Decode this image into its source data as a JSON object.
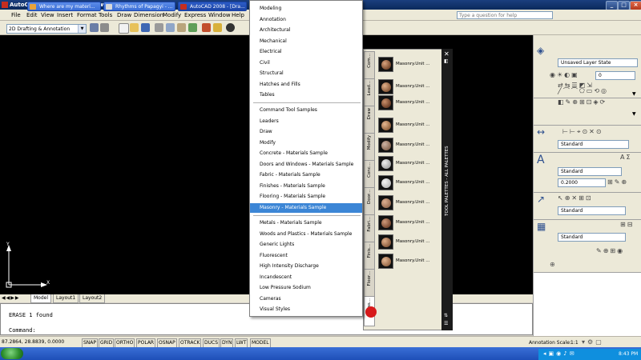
{
  "window": {
    "title": "AutoCAD 2008 - [Drawing1.dwg]",
    "min": "_",
    "max": "□",
    "close": "×"
  },
  "menu": [
    "File",
    "Edit",
    "View",
    "Insert",
    "Format",
    "Tools",
    "Draw",
    "Dimension",
    "Modify",
    "Express",
    "Window",
    "Help"
  ],
  "help_placeholder": "Type a question for help",
  "workspace": "2D Drafting & Annotation",
  "dropdown": {
    "group1": [
      "Modeling",
      "Annotation",
      "Architectural",
      "Mechanical",
      "Electrical",
      "Civil",
      "Structural",
      "Hatches and Fills",
      "Tables"
    ],
    "group2": [
      "Command Tool Samples",
      "Leaders",
      "Draw",
      "Modify",
      "Concrete - Materials Sample",
      "Doors and Windows - Materials Sample",
      "Fabric - Materials Sample",
      "Finishes - Materials Sample",
      "Flooring - Materials Sample",
      "Masonry - Materials Sample"
    ],
    "group3": [
      "Metals - Materials Sample",
      "Woods and Plastics - Materials Sample",
      "Generic Lights",
      "Fluorescent",
      "High Intensity Discharge",
      "Incandescent",
      "Low Pressure Sodium",
      "Cameras",
      "Visual Styles"
    ],
    "selected": "Masonry - Materials Sample"
  },
  "palette": {
    "title": "TOOL PALETTES - ALL PALETTES",
    "close": "✕",
    "tabs": [
      "Com...",
      "Lead...",
      "Draw",
      "Modify",
      "Conc...",
      "Door...",
      "Fabri...",
      "Finis...",
      "Floor...",
      "Mas..."
    ],
    "tools": [
      "Masonry.Unit ...",
      "Masonry.Unit ...",
      "Masonry.Unit ...",
      "Masonry.Unit ...",
      "Masonry.Unit ...",
      "Masonry.Unit ...",
      "Masonry.Unit ...",
      "Masonry.Unit ...",
      "Masonry.Unit ...",
      "Masonry.Unit ...",
      "Masonry.Unit ..."
    ],
    "swatch_colors": [
      "#7a4a2e",
      "#8a5a3a",
      "#6e3f28",
      "#94643f",
      "#8b6a55",
      "#a9a9a9",
      "#c0c0c0",
      "#9c7055",
      "#7c4b33",
      "#8d5e40",
      "#9a6b4a"
    ]
  },
  "layout_tabs": [
    "Model",
    "Layout1",
    "Layout2"
  ],
  "command": {
    "line1": "ERASE 1 found",
    "line2": "Command:"
  },
  "status": {
    "coords": "87.2864, 28.8839, 0.0000",
    "toggles": [
      "SNAP",
      "GRID",
      "ORTHO",
      "POLAR",
      "OSNAP",
      "OTRACK",
      "DUCS",
      "DYN",
      "LWT",
      "MODEL"
    ],
    "annotation_scale_label": "Annotation Scale:",
    "annotation_scale": "1:1"
  },
  "right_panel": {
    "layer_state": "Unsaved Layer State",
    "layer_value": "0",
    "text_style": "Standard",
    "dim_style": "Standard",
    "text_height": "0.2000",
    "table_style": "Standard",
    "mleader_style": "Standard"
  },
  "taskbar": {
    "tasks": [
      "Where are my materi...",
      "Rhythms of Papagyi - ...",
      "AutoCAD 2008 - [Dra..."
    ],
    "time": "8:43 PM"
  },
  "axis": {
    "x": "X",
    "y": "Y"
  }
}
